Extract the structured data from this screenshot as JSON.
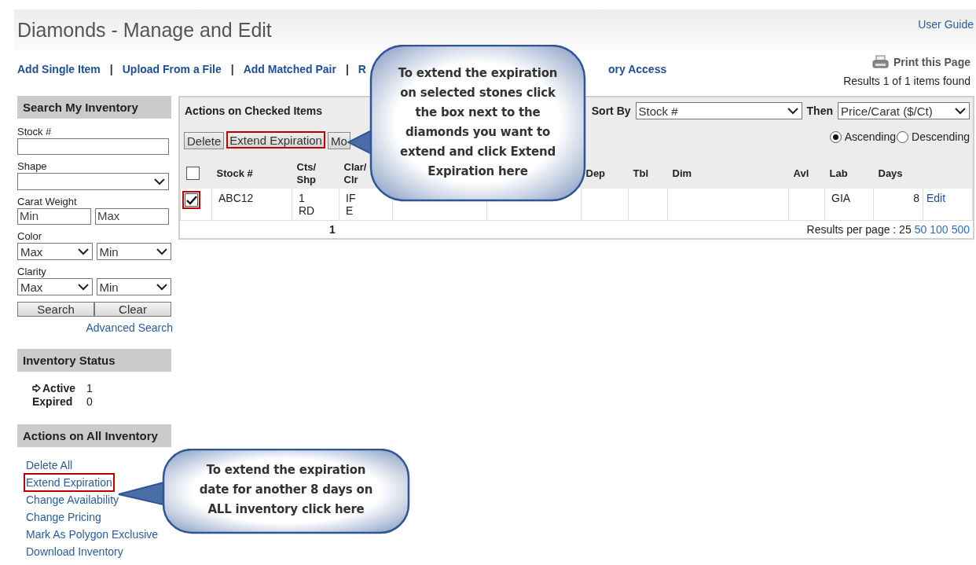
{
  "header": {
    "title": "Diamonds - Manage and Edit",
    "user_guide": "User Guide"
  },
  "nav_links": [
    {
      "kind": "link",
      "text": "Add Single Item"
    },
    {
      "kind": "separator",
      "text": "|"
    },
    {
      "kind": "link",
      "text": "Upload From a File"
    },
    {
      "kind": "separator",
      "text": "|"
    },
    {
      "kind": "link",
      "text": "Add Matched Pair"
    },
    {
      "kind": "separator",
      "text": "|"
    },
    {
      "kind": "link",
      "text": "R"
    },
    {
      "kind": "link",
      "text": "ory Access"
    }
  ],
  "print_link": "Print this Page",
  "results_found": "Results 1 of 1 items found",
  "sidebar": {
    "search": {
      "title": "Search My Inventory",
      "fields": [
        {
          "kind": "text",
          "label": "Stock #"
        },
        {
          "kind": "select",
          "label": "Shape"
        },
        {
          "kind": "range",
          "label": "Carat Weight",
          "placeholders": [
            "Min",
            "Max"
          ]
        },
        {
          "kind": "select-pair",
          "label": "Color",
          "values": [
            "Max",
            "Min"
          ]
        },
        {
          "kind": "select-pair",
          "label": "Clarity",
          "values": [
            "Max",
            "Min"
          ]
        }
      ],
      "buttons": [
        "Search",
        "Clear"
      ],
      "advanced_link": "Advanced Search"
    },
    "status": {
      "title": "Inventory Status",
      "items": [
        {
          "label": "Active",
          "count": "1",
          "selected": true
        },
        {
          "label": "Expired",
          "count": "0",
          "selected": false
        }
      ]
    },
    "actions": {
      "title": "Actions on All Inventory",
      "links": [
        {
          "label": "Delete All",
          "highlighted": false
        },
        {
          "label": "Extend Expiration",
          "highlighted": true
        },
        {
          "label": "Change Availability",
          "highlighted": false
        },
        {
          "label": "Change Pricing",
          "highlighted": false
        },
        {
          "label": "Mark As Polygon Exclusive",
          "highlighted": false
        },
        {
          "label": "Download Inventory",
          "highlighted": false
        }
      ]
    }
  },
  "main": {
    "title": "Actions on Checked Items",
    "buttons": [
      {
        "label": "Delete",
        "highlighted": false
      },
      {
        "label": "Extend Expiration",
        "highlighted": true
      },
      {
        "label": "Mo",
        "highlighted": false
      }
    ],
    "sort": {
      "label": "Sort By",
      "value": "Stock #",
      "then_label": "Then",
      "then_value": "Price/Carat ($/Ct)",
      "options": [
        {
          "label": "Ascending",
          "selected": true
        },
        {
          "label": "Descending",
          "selected": false
        }
      ]
    },
    "table": {
      "select_all": {
        "checked": false
      },
      "columns": [
        {
          "label": "Stock #"
        },
        {
          "label": "Cts/\nShp"
        },
        {
          "label": "Clar/\nClr"
        },
        {},
        {},
        {
          "label": "Dep"
        },
        {
          "label": "Tbl"
        },
        {
          "label": "Dim"
        },
        {
          "label": "Avl"
        },
        {
          "label": "Lab"
        },
        {
          "label": "Days"
        }
      ],
      "rows": [
        {
          "checked": true,
          "highlighted": true,
          "cells": [
            {
              "text": "ABC12"
            },
            {
              "text": "1\nRD"
            },
            {
              "text": "IF\nE"
            },
            {},
            {},
            {},
            {},
            {},
            {},
            {
              "text": "GIA"
            },
            {
              "text": "8"
            }
          ],
          "action": "Edit"
        }
      ]
    },
    "pagination": {
      "page": "1",
      "per_page_label": "Results per page : 25",
      "per_page_links": [
        "50",
        "100",
        "500"
      ]
    }
  },
  "callouts": [
    {
      "text": "To extend the expiration on selected stones click the box next to the diamonds you want to extend and click Extend Expiration here"
    },
    {
      "text": "To extend the expiration date for another 8 days on ALL inventory click here"
    }
  ]
}
